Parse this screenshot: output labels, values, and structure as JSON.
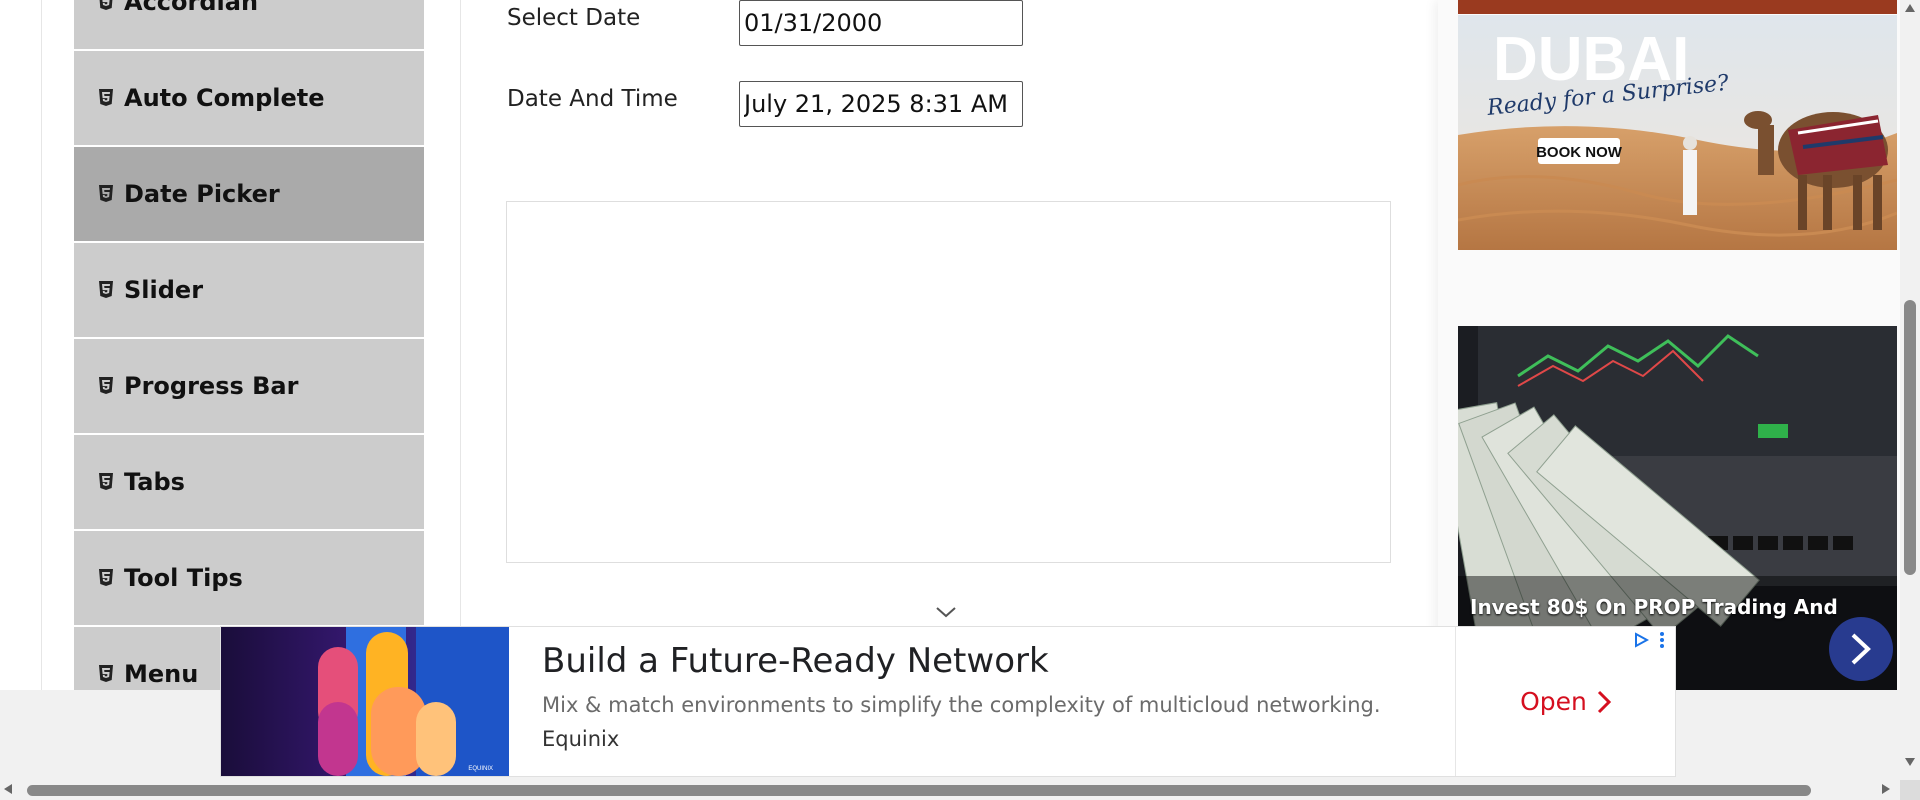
{
  "sidebar": {
    "items": [
      {
        "label": "Accordian",
        "icon": "html5-icon"
      },
      {
        "label": "Auto Complete",
        "icon": "html5-icon"
      },
      {
        "label": "Date Picker",
        "icon": "html5-icon",
        "active": true
      },
      {
        "label": "Slider",
        "icon": "html5-icon"
      },
      {
        "label": "Progress Bar",
        "icon": "html5-icon"
      },
      {
        "label": "Tabs",
        "icon": "html5-icon"
      },
      {
        "label": "Tool Tips",
        "icon": "html5-icon"
      },
      {
        "label": "Menu",
        "icon": "html5-icon"
      }
    ]
  },
  "form": {
    "select_date_label": "Select Date",
    "select_date_value": "01/31/2000",
    "date_time_label": "Date And Time",
    "date_time_value": "July 21, 2025 8:31 AM"
  },
  "ads": {
    "dubai": {
      "brand": "DUBAI",
      "tagline": "Ready for a Surprise?",
      "cta": "BOOK NOW"
    },
    "trading": {
      "caption": "Invest 80$ On PROP Trading And"
    },
    "bottom": {
      "headline": "Build a Future-Ready Network",
      "description": "Mix & match environments to simplify the complexity of multicloud networking.",
      "advertiser": "Equinix",
      "open_label": "Open",
      "logo_text": "EQUINIX"
    }
  },
  "colors": {
    "sidebar_bg": "#cccccc",
    "sidebar_active_bg": "#aaaaaa",
    "ad_open": "#d50f1f",
    "trade_next_bg": "#283b8f"
  }
}
